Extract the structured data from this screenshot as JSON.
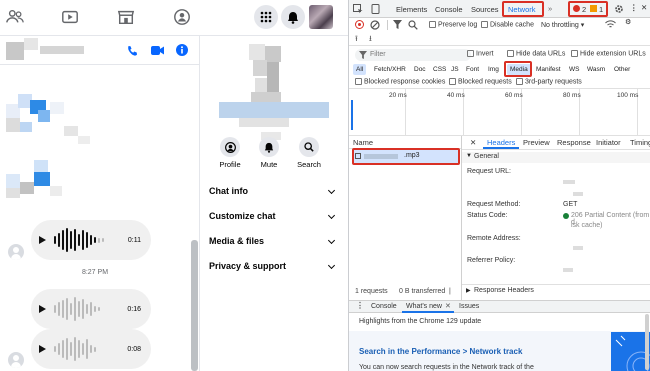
{
  "colors": {
    "messenger_blue": "#0866ff",
    "devtools_blue": "#1a73e8",
    "highlight_red": "#d93025",
    "error_red": "#d93025",
    "warn_orange": "#f29900"
  },
  "chat": {
    "timestamp": "8:27 PM",
    "voice_messages": [
      {
        "duration": "0:11"
      },
      {
        "duration": "0:16"
      },
      {
        "duration": "0:08"
      }
    ]
  },
  "info_panel": {
    "actions": [
      {
        "label": "Profile",
        "icon": "user-circle-icon"
      },
      {
        "label": "Mute",
        "icon": "bell-icon"
      },
      {
        "label": "Search",
        "icon": "search-icon"
      }
    ],
    "sections": [
      {
        "label": "Chat info"
      },
      {
        "label": "Customize chat"
      },
      {
        "label": "Media & files"
      },
      {
        "label": "Privacy & support"
      }
    ]
  },
  "devtools": {
    "top_tabs": [
      "Elements",
      "Console",
      "Sources",
      "Network"
    ],
    "active_tab": "Network",
    "error_count": "2",
    "warning_count": "1",
    "toolbar": {
      "preserve_log": "Preserve log",
      "disable_cache": "Disable cache",
      "throttling": "No throttling"
    },
    "filter": {
      "placeholder": "Filter",
      "invert": "Invert",
      "hide_data_urls": "Hide data URLs",
      "hide_extension_urls": "Hide extension URLs"
    },
    "type_filters": [
      "All",
      "Fetch/XHR",
      "Doc",
      "CSS",
      "JS",
      "Font",
      "Img",
      "Media",
      "Manifest",
      "WS",
      "Wasm",
      "Other"
    ],
    "active_type": "Media",
    "blocked": {
      "response_cookies": "Blocked response cookies",
      "requests": "Blocked requests",
      "third_party": "3rd-party requests"
    },
    "timeline_ticks": [
      "20 ms",
      "40 ms",
      "60 ms",
      "80 ms",
      "100 ms"
    ],
    "name_column": "Name",
    "request_name": ".mp3",
    "detail_tabs": [
      "Headers",
      "Preview",
      "Response",
      "Initiator",
      "Timing"
    ],
    "active_detail_tab": "Headers",
    "general": {
      "title": "General",
      "request_url_label": "Request URL:",
      "request_method_label": "Request Method:",
      "request_method_value": "GET",
      "status_code_label": "Status Code:",
      "status_code_value": "206 Partial Content (from d",
      "status_code_value_2": "isk cache)",
      "remote_address_label": "Remote Address:",
      "referrer_policy_label": "Referrer Policy:"
    },
    "response_headers": "Response Headers",
    "status_bar": {
      "requests": "1 requests",
      "transferred": "0 B transferred"
    },
    "drawer": {
      "tabs": [
        "Console",
        "What's new",
        "Issues"
      ],
      "active": "What's new",
      "highlights": "Highlights from the Chrome 129 update",
      "heading": "Search in the Performance > Network track",
      "body": "You can now search requests in the Network track of the"
    }
  }
}
